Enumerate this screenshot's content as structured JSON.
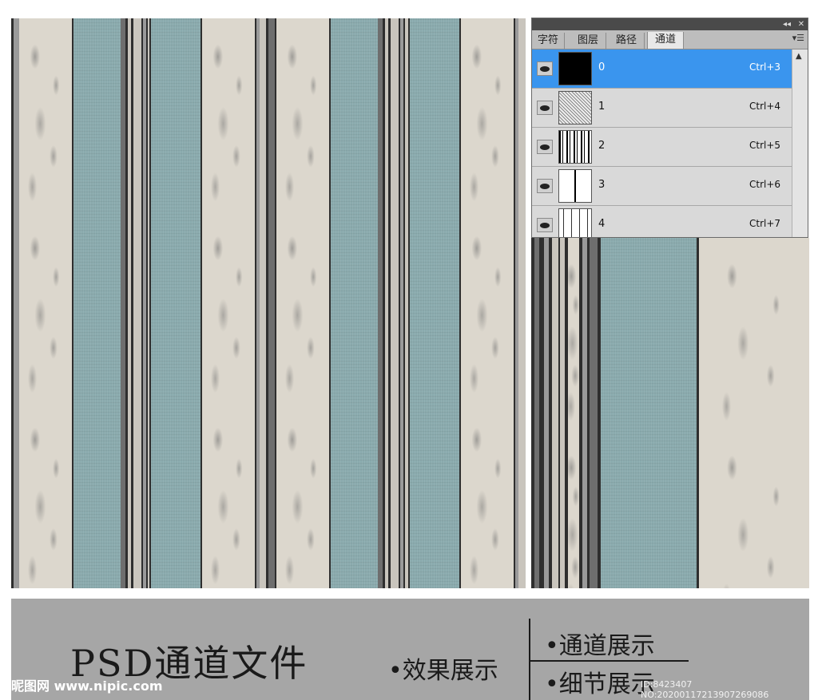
{
  "panel": {
    "tabs": [
      "字符",
      "图层",
      "路径",
      "通道"
    ],
    "active_tab": "通道",
    "collapse_icon": "double-chevron-left-icon",
    "close_icon": "close-icon",
    "menu_icon": "panel-menu-icon",
    "selected_color": "#3a95ee",
    "channels": [
      {
        "name": "0",
        "shortcut": "Ctrl+3",
        "selected": true
      },
      {
        "name": "1",
        "shortcut": "Ctrl+4",
        "selected": false
      },
      {
        "name": "2",
        "shortcut": "Ctrl+5",
        "selected": false
      },
      {
        "name": "3",
        "shortcut": "Ctrl+6",
        "selected": false
      },
      {
        "name": "4",
        "shortcut": "Ctrl+7",
        "selected": false
      }
    ]
  },
  "caption": {
    "title": "PSD通道文件",
    "effect_label": "•效果展示",
    "channel_label": "•通道展示",
    "detail_label": "•细节展示"
  },
  "watermark": {
    "site": "昵图网 www.nipic.com",
    "id_text": "ID:8423407 NO:20200117213907269086"
  },
  "colors": {
    "wallpaper_blue": "#8aaaad",
    "wallpaper_beige": "#dcd7cd",
    "caption_band": "#a6a6a6"
  }
}
